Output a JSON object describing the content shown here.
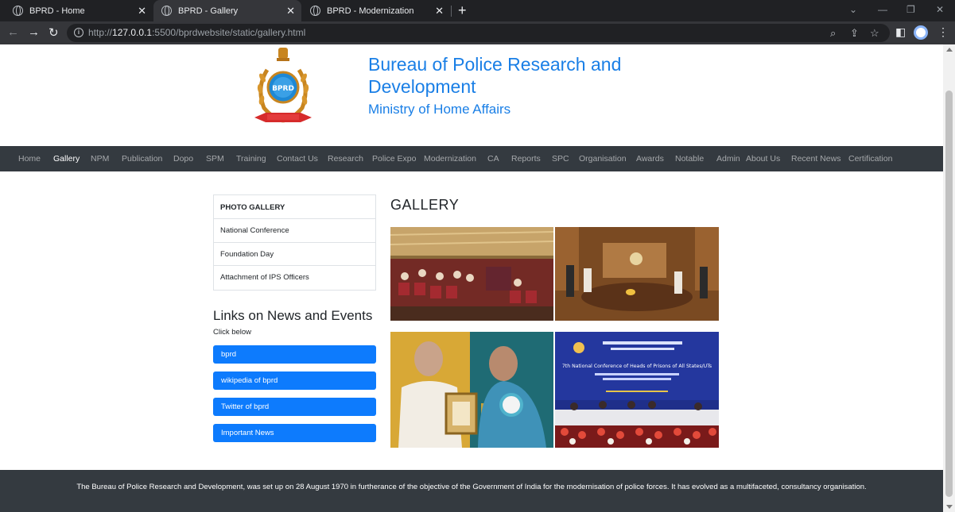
{
  "browser": {
    "tabs": [
      {
        "title": "BPRD - Home",
        "active": false
      },
      {
        "title": "BPRD - Gallery",
        "active": true
      },
      {
        "title": "BPRD - Modernization",
        "active": false
      }
    ],
    "url_prefix": "http://",
    "url_host": "127.0.0.1",
    "url_rest": ":5500/bprdwebsite/static/gallery.html"
  },
  "header": {
    "title": "Bureau of Police Research and Development",
    "subtitle": "Ministry of Home Affairs",
    "emblem_text": "BPRD"
  },
  "navbar": {
    "items": [
      "Home",
      "Gallery",
      "NPM",
      "Publication",
      "Dopo",
      "SPM",
      "Training",
      "Contact Us",
      "Research",
      "Police Expo",
      "Modernization",
      "CA",
      "Reports",
      "SPC",
      "Organisation",
      "Awards",
      "Notable",
      "Admin",
      "About Us",
      "Recent News",
      "Certification"
    ],
    "active": "Gallery"
  },
  "sidebar": {
    "heading": "PHOTO GALLERY",
    "items": [
      "National Conference",
      "Foundation Day",
      "Attachment of IPS Officers"
    ]
  },
  "links": {
    "title": "Links on News and Events",
    "subtitle": "Click below",
    "buttons": [
      "bprd",
      "wikipedia of bprd",
      "Twitter of bprd",
      "Important News"
    ]
  },
  "gallery": {
    "title": "GALLERY",
    "banner_text": "7th National Conference of Heads of Prisons of All States/UTs"
  },
  "footer": {
    "text": "The Bureau of Police Research and Development, was set up on 28 August 1970 in furtherance of the objective of the Government of India for the modernisation of police forces. It has evolved as a multifaceted, consultancy organisation."
  },
  "colors": {
    "brand_blue": "#1a7fe6",
    "navbar_bg": "#343a40",
    "button_blue": "#0d7bfd"
  }
}
